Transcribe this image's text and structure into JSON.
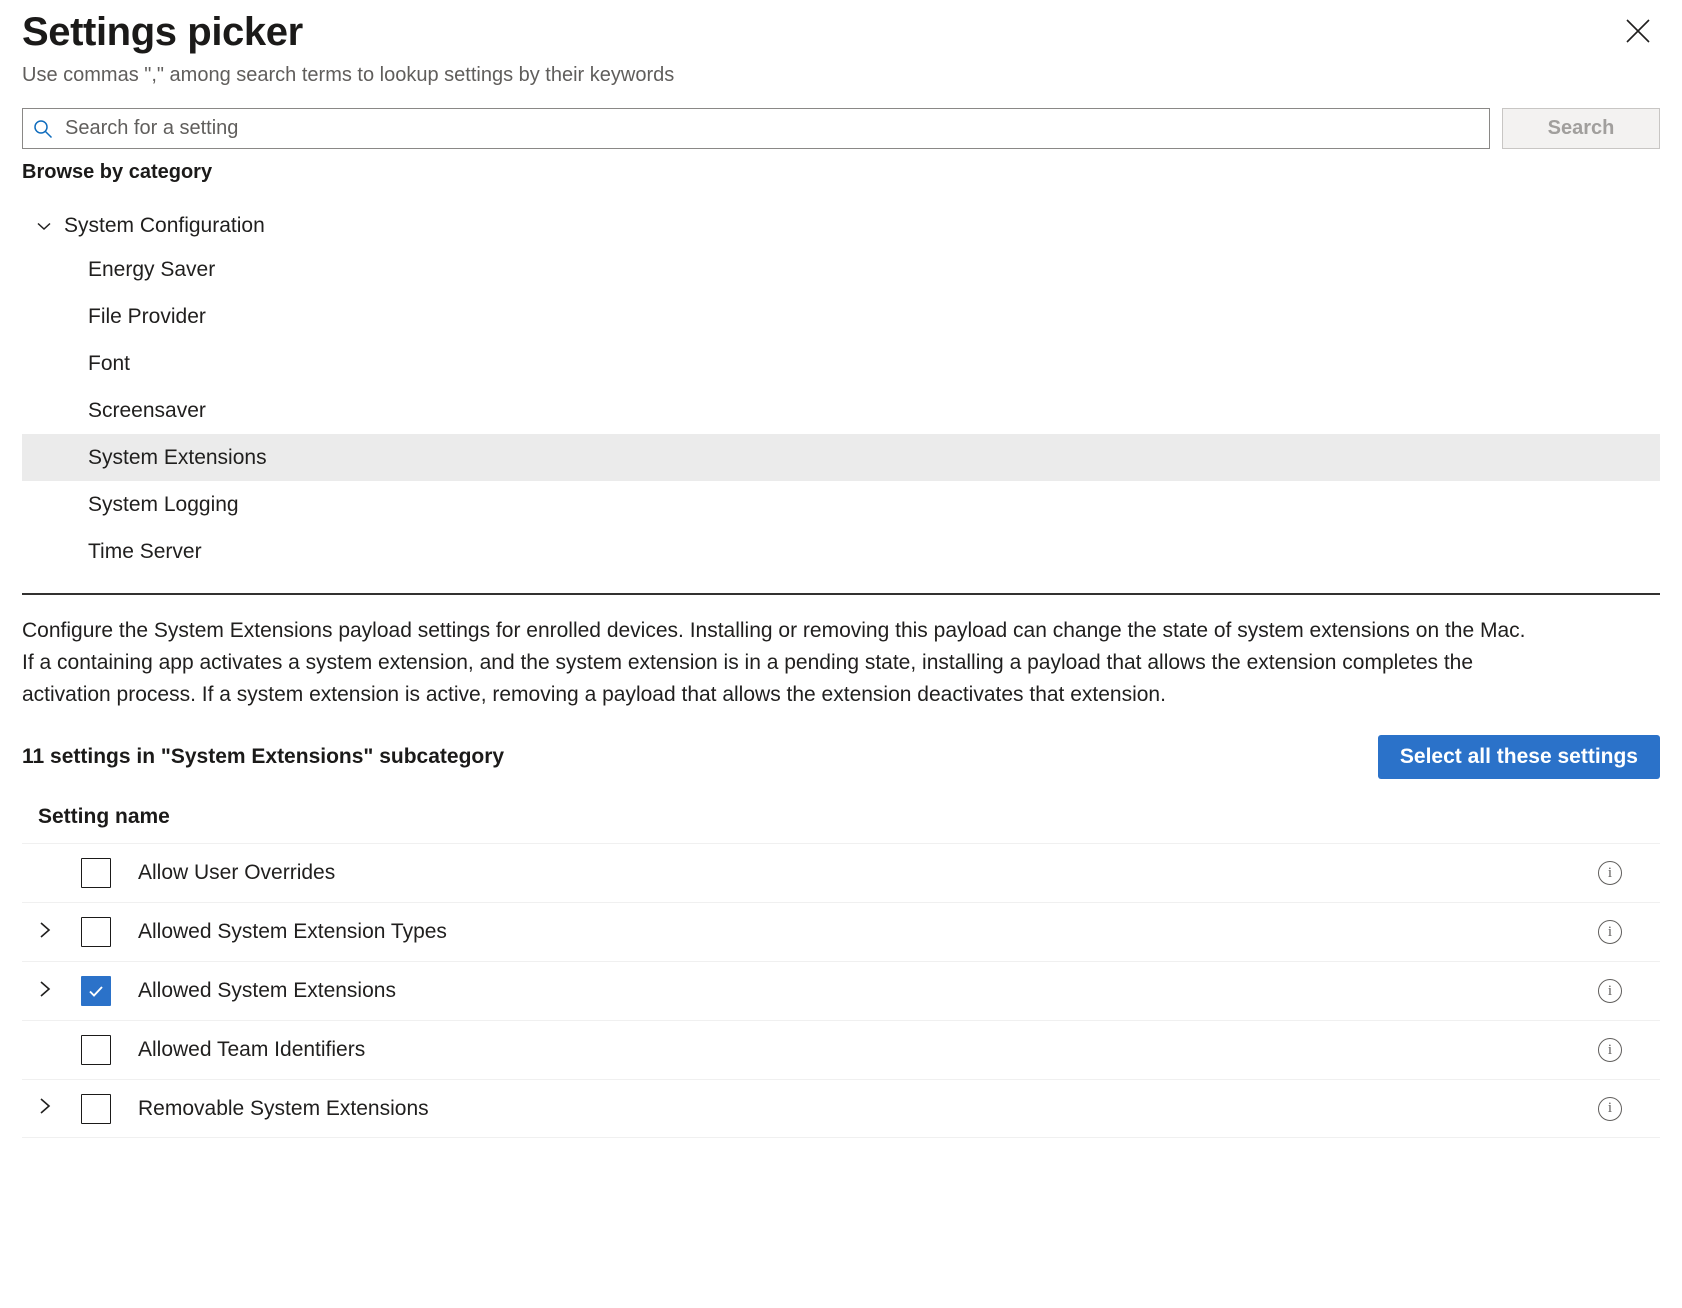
{
  "header": {
    "title": "Settings picker",
    "subtitle": "Use commas \",\" among search terms to lookup settings by their keywords",
    "close_icon": "close-icon"
  },
  "search": {
    "placeholder": "Search for a setting",
    "value": "",
    "icon": "search-icon",
    "button_label": "Search",
    "button_disabled": true
  },
  "browse": {
    "label": "Browse by category",
    "group": {
      "label": "System Configuration",
      "expanded": true,
      "chevron_icon": "chevron-down-icon"
    },
    "items": [
      {
        "label": "Energy Saver",
        "selected": false
      },
      {
        "label": "File Provider",
        "selected": false
      },
      {
        "label": "Font",
        "selected": false
      },
      {
        "label": "Screensaver",
        "selected": false
      },
      {
        "label": "System Extensions",
        "selected": true
      },
      {
        "label": "System Logging",
        "selected": false
      },
      {
        "label": "Time Server",
        "selected": false
      }
    ]
  },
  "description": "Configure the System Extensions payload settings for enrolled devices. Installing or removing this payload can change the state of system extensions on the Mac. If a containing app activates a system extension, and the system extension is in a pending state, installing a payload that allows the extension completes the activation process. If a system extension is active, removing a payload that allows the extension deactivates that extension.",
  "settings_list": {
    "count_text": "11 settings in \"System Extensions\" subcategory",
    "select_all_label": "Select all these settings",
    "accent_color": "#2b72c9",
    "column_header": "Setting name",
    "rows": [
      {
        "label": "Allow User Overrides",
        "checked": false,
        "expandable": false,
        "info_icon": "info-icon"
      },
      {
        "label": "Allowed System Extension Types",
        "checked": false,
        "expandable": true,
        "info_icon": "info-icon"
      },
      {
        "label": "Allowed System Extensions",
        "checked": true,
        "expandable": true,
        "info_icon": "info-icon"
      },
      {
        "label": "Allowed Team Identifiers",
        "checked": false,
        "expandable": false,
        "info_icon": "info-icon"
      },
      {
        "label": "Removable System Extensions",
        "checked": false,
        "expandable": true,
        "info_icon": "info-icon"
      }
    ]
  }
}
